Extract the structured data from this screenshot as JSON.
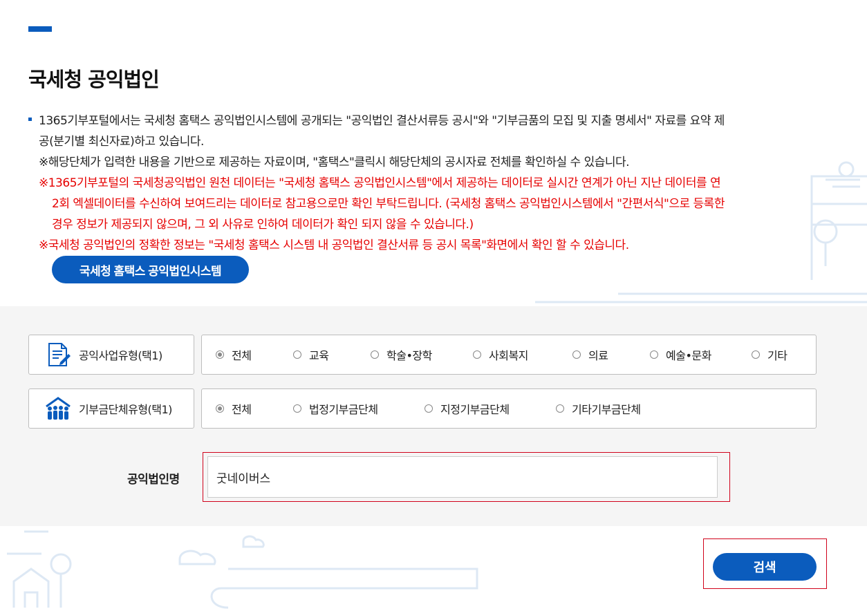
{
  "page": {
    "title": "국세청 공익법인"
  },
  "notice": {
    "line1": "1365기부포털에서는 국세청 홈택스 공익법인시스템에 공개되는 \"공익법인 결산서류등 공시\"와 \"기부금품의 모집 및 지출 명세서\" 자료를 요약 제",
    "line2": "공(분기별 최신자료)하고 있습니다.",
    "note1": "※해당단체가 입력한 내용을 기반으로 제공하는 자료이며, \"홈택스\"클릭시 해당단체의 공시자료 전체를 확인하실 수 있습니다.",
    "warn1_line1": "※1365기부포털의 국세청공익법인 원천 데이터는 \"국세청 홈택스 공익법인시스템\"에서 제공하는 데이터로 실시간 연계가 아닌 지난 데이터를 연",
    "warn1_line2": "2회 엑셀데이터를 수신하여 보여드리는 데이터로 참고용으로만 확인 부탁드립니다. (국세청 홈택스 공익법인시스템에서 \"간편서식\"으로 등록한",
    "warn1_line3": "경우 정보가 제공되지 않으며, 그 외 사유로 인하여 데이터가 확인 되지 않을 수 있습니다.)",
    "warn2": "※국세청 공익법인의 정확한 정보는 \"국세청 홈택스 시스템 내 공익법인 결산서류 등 공시 목록\"화면에서 확인 할 수 있습니다."
  },
  "hometax_button": "국세청 홈택스 공익법인시스템",
  "filters": {
    "business_type": {
      "label": "공익사업유형(택1)",
      "icon": "document-edit-icon",
      "options": [
        "전체",
        "교육",
        "학술•장학",
        "사회복지",
        "의료",
        "예술•문화",
        "기타"
      ],
      "selected": "전체"
    },
    "org_type": {
      "label": "기부금단체유형(택1)",
      "icon": "group-people-icon",
      "options": [
        "전체",
        "법정기부금단체",
        "지정기부금단체",
        "기타기부금단체"
      ],
      "selected": "전체"
    }
  },
  "name_field": {
    "label": "공익법인명",
    "value": "굿네이버스"
  },
  "search_button": "검색",
  "colors": {
    "primary": "#0b5cbd",
    "warning": "#e60000",
    "highlight_outline": "#d0021b",
    "panel_bg": "#f5f5f5"
  }
}
